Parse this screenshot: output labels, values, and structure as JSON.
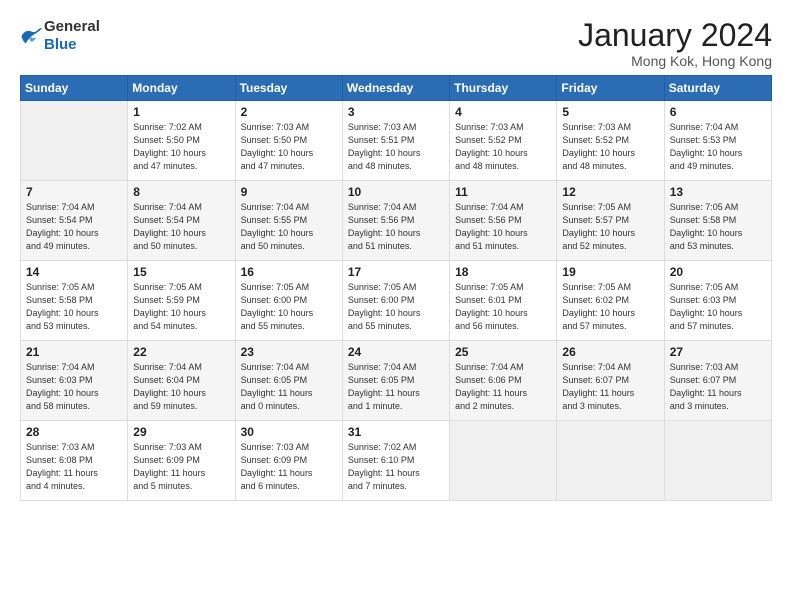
{
  "logo": {
    "general": "General",
    "blue": "Blue"
  },
  "title": "January 2024",
  "subtitle": "Mong Kok, Hong Kong",
  "headers": [
    "Sunday",
    "Monday",
    "Tuesday",
    "Wednesday",
    "Thursday",
    "Friday",
    "Saturday"
  ],
  "weeks": [
    [
      {
        "num": "",
        "info": ""
      },
      {
        "num": "1",
        "info": "Sunrise: 7:02 AM\nSunset: 5:50 PM\nDaylight: 10 hours\nand 47 minutes."
      },
      {
        "num": "2",
        "info": "Sunrise: 7:03 AM\nSunset: 5:50 PM\nDaylight: 10 hours\nand 47 minutes."
      },
      {
        "num": "3",
        "info": "Sunrise: 7:03 AM\nSunset: 5:51 PM\nDaylight: 10 hours\nand 48 minutes."
      },
      {
        "num": "4",
        "info": "Sunrise: 7:03 AM\nSunset: 5:52 PM\nDaylight: 10 hours\nand 48 minutes."
      },
      {
        "num": "5",
        "info": "Sunrise: 7:03 AM\nSunset: 5:52 PM\nDaylight: 10 hours\nand 48 minutes."
      },
      {
        "num": "6",
        "info": "Sunrise: 7:04 AM\nSunset: 5:53 PM\nDaylight: 10 hours\nand 49 minutes."
      }
    ],
    [
      {
        "num": "7",
        "info": "Sunrise: 7:04 AM\nSunset: 5:54 PM\nDaylight: 10 hours\nand 49 minutes."
      },
      {
        "num": "8",
        "info": "Sunrise: 7:04 AM\nSunset: 5:54 PM\nDaylight: 10 hours\nand 50 minutes."
      },
      {
        "num": "9",
        "info": "Sunrise: 7:04 AM\nSunset: 5:55 PM\nDaylight: 10 hours\nand 50 minutes."
      },
      {
        "num": "10",
        "info": "Sunrise: 7:04 AM\nSunset: 5:56 PM\nDaylight: 10 hours\nand 51 minutes."
      },
      {
        "num": "11",
        "info": "Sunrise: 7:04 AM\nSunset: 5:56 PM\nDaylight: 10 hours\nand 51 minutes."
      },
      {
        "num": "12",
        "info": "Sunrise: 7:05 AM\nSunset: 5:57 PM\nDaylight: 10 hours\nand 52 minutes."
      },
      {
        "num": "13",
        "info": "Sunrise: 7:05 AM\nSunset: 5:58 PM\nDaylight: 10 hours\nand 53 minutes."
      }
    ],
    [
      {
        "num": "14",
        "info": "Sunrise: 7:05 AM\nSunset: 5:58 PM\nDaylight: 10 hours\nand 53 minutes."
      },
      {
        "num": "15",
        "info": "Sunrise: 7:05 AM\nSunset: 5:59 PM\nDaylight: 10 hours\nand 54 minutes."
      },
      {
        "num": "16",
        "info": "Sunrise: 7:05 AM\nSunset: 6:00 PM\nDaylight: 10 hours\nand 55 minutes."
      },
      {
        "num": "17",
        "info": "Sunrise: 7:05 AM\nSunset: 6:00 PM\nDaylight: 10 hours\nand 55 minutes."
      },
      {
        "num": "18",
        "info": "Sunrise: 7:05 AM\nSunset: 6:01 PM\nDaylight: 10 hours\nand 56 minutes."
      },
      {
        "num": "19",
        "info": "Sunrise: 7:05 AM\nSunset: 6:02 PM\nDaylight: 10 hours\nand 57 minutes."
      },
      {
        "num": "20",
        "info": "Sunrise: 7:05 AM\nSunset: 6:03 PM\nDaylight: 10 hours\nand 57 minutes."
      }
    ],
    [
      {
        "num": "21",
        "info": "Sunrise: 7:04 AM\nSunset: 6:03 PM\nDaylight: 10 hours\nand 58 minutes."
      },
      {
        "num": "22",
        "info": "Sunrise: 7:04 AM\nSunset: 6:04 PM\nDaylight: 10 hours\nand 59 minutes."
      },
      {
        "num": "23",
        "info": "Sunrise: 7:04 AM\nSunset: 6:05 PM\nDaylight: 11 hours\nand 0 minutes."
      },
      {
        "num": "24",
        "info": "Sunrise: 7:04 AM\nSunset: 6:05 PM\nDaylight: 11 hours\nand 1 minute."
      },
      {
        "num": "25",
        "info": "Sunrise: 7:04 AM\nSunset: 6:06 PM\nDaylight: 11 hours\nand 2 minutes."
      },
      {
        "num": "26",
        "info": "Sunrise: 7:04 AM\nSunset: 6:07 PM\nDaylight: 11 hours\nand 3 minutes."
      },
      {
        "num": "27",
        "info": "Sunrise: 7:03 AM\nSunset: 6:07 PM\nDaylight: 11 hours\nand 3 minutes."
      }
    ],
    [
      {
        "num": "28",
        "info": "Sunrise: 7:03 AM\nSunset: 6:08 PM\nDaylight: 11 hours\nand 4 minutes."
      },
      {
        "num": "29",
        "info": "Sunrise: 7:03 AM\nSunset: 6:09 PM\nDaylight: 11 hours\nand 5 minutes."
      },
      {
        "num": "30",
        "info": "Sunrise: 7:03 AM\nSunset: 6:09 PM\nDaylight: 11 hours\nand 6 minutes."
      },
      {
        "num": "31",
        "info": "Sunrise: 7:02 AM\nSunset: 6:10 PM\nDaylight: 11 hours\nand 7 minutes."
      },
      {
        "num": "",
        "info": ""
      },
      {
        "num": "",
        "info": ""
      },
      {
        "num": "",
        "info": ""
      }
    ]
  ]
}
